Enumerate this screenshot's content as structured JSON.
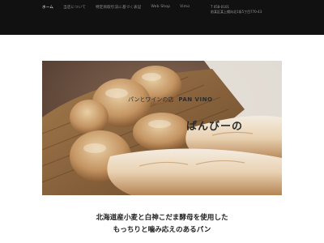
{
  "nav": {
    "items": [
      "ホーム",
      "当店について",
      "特定商取引法に基づく表記",
      "Web Shop",
      "Vimo"
    ]
  },
  "contact": {
    "phone": "T 058-0101",
    "address": "前某区某上幌向北1条5丁目770-43"
  },
  "hero": {
    "shop_tagline": "パンとワインの店",
    "shop_name": "PAN VINO",
    "shop_name_kana": "ぱんびーの"
  },
  "headline": {
    "line1": "北海道産小麦と白神こだま酵母を使用した",
    "line2": "もっちりと噛み応えのあるパン"
  },
  "colors": {
    "topbar": "#111111",
    "nav_active": "#ffffff",
    "nav_inactive": "#8f8f8f"
  }
}
